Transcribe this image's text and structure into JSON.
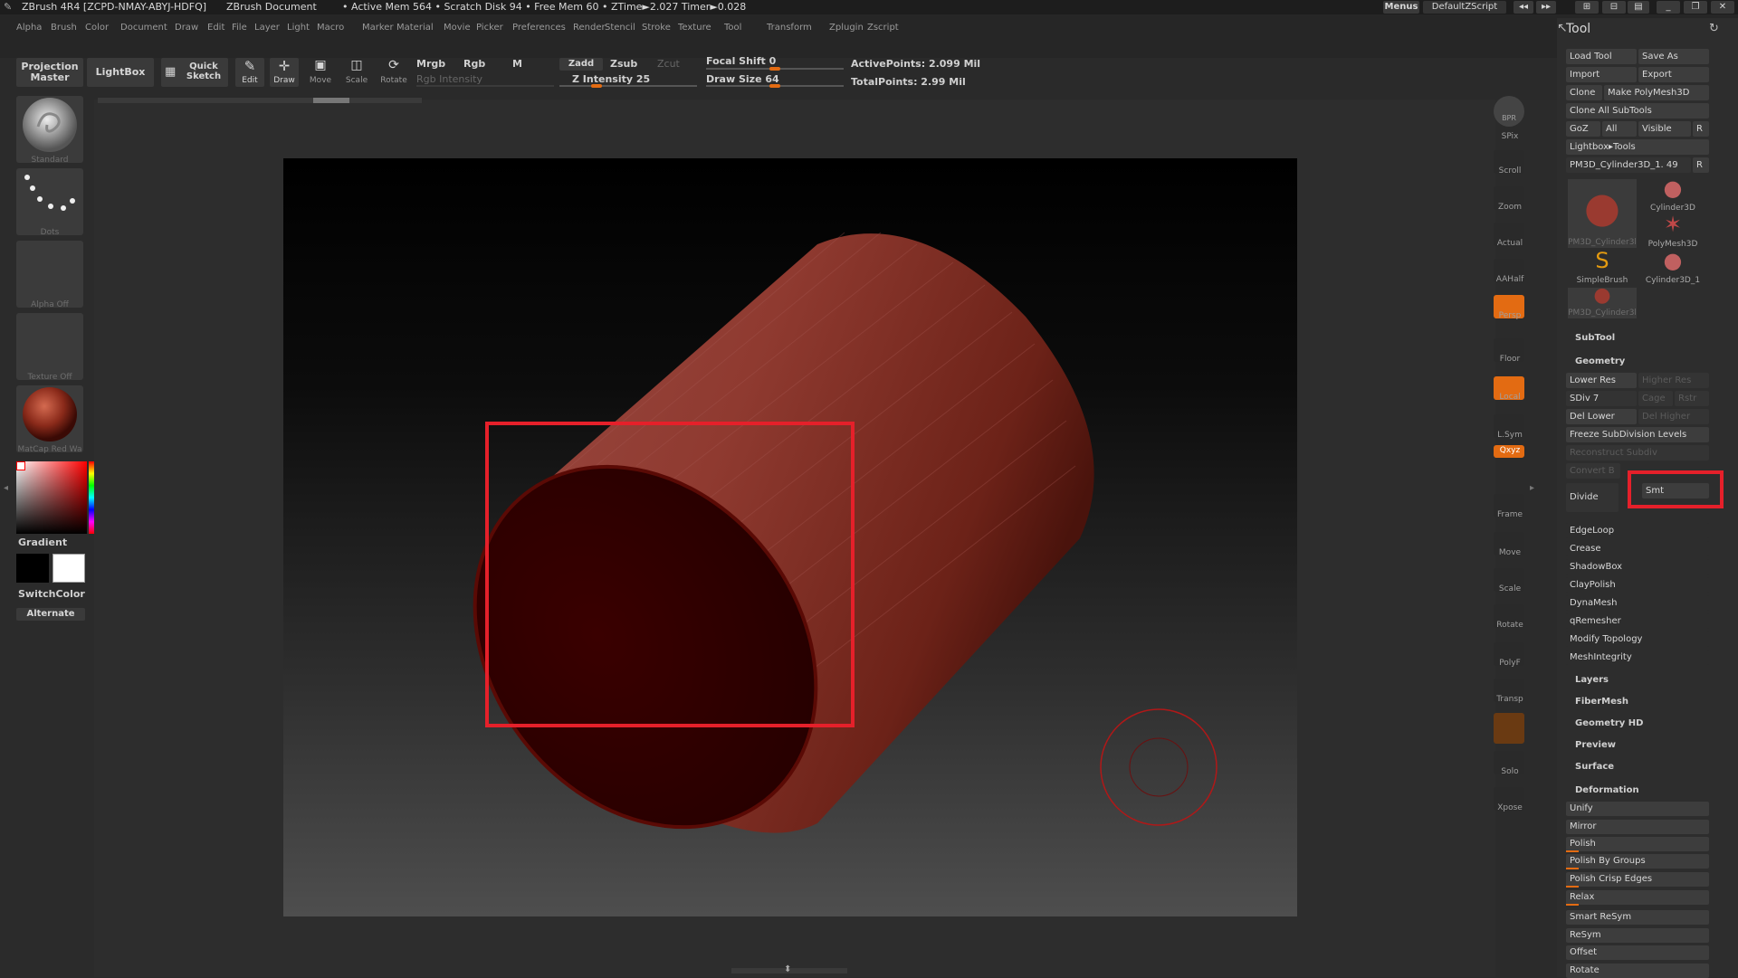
{
  "title_bar": {
    "app": "ZBrush 4R4 [ZCPD-NMAY-ABYJ-HDFQ]",
    "document": "ZBrush Document",
    "stats": "• Active Mem 564 • Scratch Disk 94 • Free Mem 60 • ZTime►2.027 Timer►0.028",
    "menus_btn": "Menus",
    "script_btn": "DefaultZScript"
  },
  "menubar": [
    "Alpha",
    "Brush",
    "Color",
    "Document",
    "Draw",
    "Edit",
    "File",
    "Layer",
    "Light",
    "Macro",
    "Marker",
    "Material",
    "Movie",
    "Picker",
    "Preferences",
    "Render",
    "Stencil",
    "Stroke",
    "Texture",
    "Tool",
    "Transform",
    "Zplugin",
    "Zscript"
  ],
  "shelf": {
    "projection_master": "Projection Master",
    "lightbox": "LightBox",
    "quick_sketch": "Quick Sketch",
    "edit": "Edit",
    "draw": "Draw",
    "move": "Move",
    "scale": "Scale",
    "rotate": "Rotate",
    "mrgb": "Mrgb",
    "rgb": "Rgb",
    "m": "M",
    "rgb_intensity": "Rgb Intensity",
    "zadd": "Zadd",
    "zsub": "Zsub",
    "zcut": "Zcut",
    "z_intensity": "Z Intensity 25",
    "focal_shift": "Focal Shift 0",
    "draw_size": "Draw Size 64",
    "active_points": "ActivePoints: 2.099 Mil",
    "total_points": "TotalPoints: 2.99 Mil",
    "z_intensity_value": 25,
    "focal_shift_value": 0,
    "draw_size_value": 64
  },
  "left_palette": {
    "brush": "Standard",
    "stroke": "Dots",
    "alpha": "Alpha Off",
    "texture": "Texture Off",
    "material": "MatCap Red Wa",
    "gradient": "Gradient",
    "switch_color": "SwitchColor",
    "alternate": "Alternate"
  },
  "right_shelf": [
    "SPix",
    "Scroll",
    "Zoom",
    "Actual",
    "AAHalf",
    "Persp",
    "Floor",
    "Local",
    "L.Sym",
    "Qxyz",
    "Frame",
    "Move",
    "Scale",
    "Rotate",
    "PolyF",
    "Transp",
    "Solo",
    "Xpose"
  ],
  "right_shelf_top": "BPR",
  "tool_panel": {
    "title": "Tool",
    "load_tool": "Load Tool",
    "save_as": "Save As",
    "import": "Import",
    "export": "Export",
    "clone": "Clone",
    "make_polymesh": "Make PolyMesh3D",
    "clone_all": "Clone All SubTools",
    "goz": "GoZ",
    "all": "All",
    "visible": "Visible",
    "r": "R",
    "lightbox_tools": "Lightbox▸Tools",
    "current_tool": "PM3D_Cylinder3D_1. 49",
    "tools": [
      {
        "label": "PM3D_Cylinder3l"
      },
      {
        "label": "Cylinder3D"
      },
      {
        "label": "PolyMesh3D"
      },
      {
        "label": "SimpleBrush"
      },
      {
        "label": "Cylinder3D_1"
      },
      {
        "label": "PM3D_Cylinder3l"
      }
    ],
    "subtool": "SubTool",
    "geometry": "Geometry",
    "lower_res": "Lower Res",
    "higher_res": "Higher Res",
    "sdiv": "SDiv 7",
    "cage": "Cage",
    "rstr": "Rstr",
    "del_lower": "Del Lower",
    "del_higher": "Del Higher",
    "freeze": "Freeze SubDivision Levels",
    "reconstruct": "Reconstruct Subdiv",
    "convert": "Convert B",
    "divide": "Divide",
    "smt": "Smt",
    "geometry_items": [
      "EdgeLoop",
      "Crease",
      "ShadowBox",
      "ClayPolish",
      "DynaMesh",
      "qRemesher",
      "Modify Topology",
      "MeshIntegrity"
    ],
    "sections": [
      "Layers",
      "FiberMesh",
      "Geometry HD",
      "Preview",
      "Surface"
    ],
    "deformation": "Deformation",
    "deformation_items": [
      "Unify",
      "Mirror",
      "Polish",
      "Polish By Groups",
      "Polish Crisp Edges",
      "Relax",
      "Smart ReSym",
      "ReSym",
      "Offset",
      "Rotate"
    ]
  },
  "colors": {
    "accent": "#e36b12",
    "highlight": "#e5202a",
    "cylinder": "#8b3a32"
  }
}
